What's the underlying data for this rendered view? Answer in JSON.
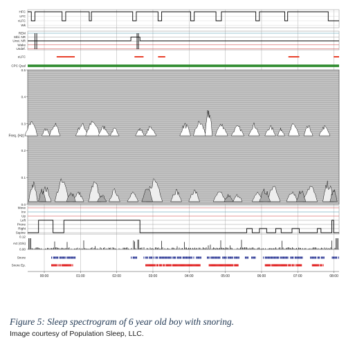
{
  "caption": "Figure 5: Sleep spectrogram of 6 year old boy with snoring.",
  "credit": "Image courtesy of Population Sleep, LLC.",
  "chart_data": {
    "type": "area",
    "panels": [
      {
        "name": "cpc_state",
        "labels": [
          "HFC",
          "LFC",
          "vLFC",
          "Wk"
        ]
      },
      {
        "name": "sleep_stage",
        "labels": [
          "REM",
          "Stbl. NR",
          "Unst. NR",
          "Wake",
          "Undef."
        ]
      },
      {
        "name": "elfc",
        "labels": [
          "eLFC"
        ]
      },
      {
        "name": "cpc_qual",
        "labels": [
          "CPC Qual"
        ]
      },
      {
        "name": "spectrogram",
        "ylabel": "Freq. (Hz)",
        "ylim": [
          0,
          0.5
        ],
        "yticks": [
          "0.5",
          "0.4",
          "0.3",
          "0.2",
          "0.1",
          "0.0"
        ]
      },
      {
        "name": "position",
        "labels": [
          "Move",
          "Inv",
          "Up",
          "Left",
          "Prone",
          "Right",
          "Supine"
        ]
      },
      {
        "name": "activity",
        "ylabel": "Act (G/s)",
        "yticks": [
          "0.12",
          "0.00"
        ]
      },
      {
        "name": "snore",
        "labels": [
          "Snore",
          "Snore Ep."
        ]
      }
    ],
    "x_ticks": [
      "00:00",
      "01:00",
      "02:00",
      "03:00",
      "04:00",
      "05:00",
      "06:00",
      "07:00",
      "08:00"
    ],
    "colors": {
      "trace": "#000000",
      "elfc": "#e8402a",
      "cpc_qual": "#2e8b2e",
      "snore": "#1f2c8f",
      "snore_ep": "#e01e1e",
      "grid": "#9a9a9a",
      "spectro_bg": "#c8c8c8"
    }
  }
}
